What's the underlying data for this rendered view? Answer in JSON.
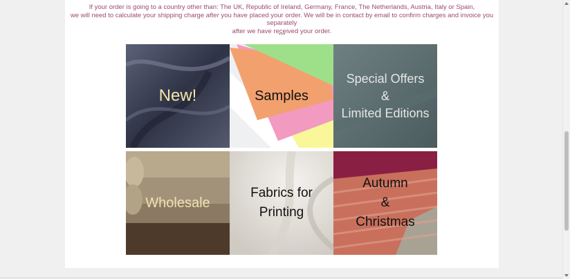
{
  "notice": {
    "line1": "If your order is going to a country other than: The UK, Republic of Ireland, Germany, France, The Netherlands, Austria, Italy or Spain,",
    "line2_pre": "we will need to calculate your shipping charge ",
    "line2_em": "after",
    "line2_post": " you have placed your order. We will be in contact by email to confirm charges and invoice you separately",
    "line3": "after we have received your order."
  },
  "separator": "---",
  "tiles": [
    {
      "label": "New!",
      "color": "#f3e6a6",
      "bg": "#3f4458"
    },
    {
      "label": "Samples",
      "color": "#111111",
      "bg": "#eef0f2"
    },
    {
      "label": "Special Offers\n&\nLimited Editions",
      "color": "#e6e6e6",
      "bg": "#56696b"
    },
    {
      "label": "Wholesale",
      "color": "#efe2b0",
      "bg": "#7a6a55"
    },
    {
      "label": "Fabrics for\nPrinting",
      "color": "#111111",
      "bg": "#e9e6e0"
    },
    {
      "label": "Autumn\n&\nChristmas",
      "color": "#111111",
      "bg": "#c86a58"
    }
  ]
}
